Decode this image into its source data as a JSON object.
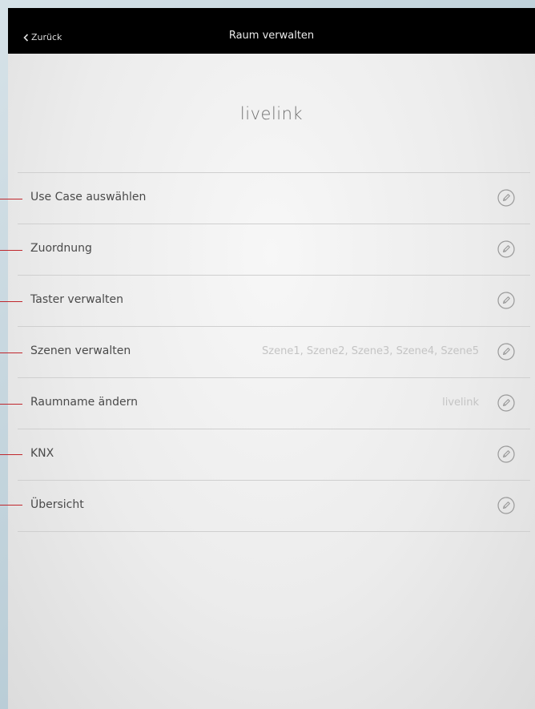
{
  "navbar": {
    "back_label": "Zurück",
    "title": "Raum verwalten"
  },
  "room": {
    "name": "livelink"
  },
  "items": [
    {
      "label": "Use Case auswählen",
      "value": ""
    },
    {
      "label": "Zuordnung",
      "value": ""
    },
    {
      "label": "Taster verwalten",
      "value": ""
    },
    {
      "label": "Szenen verwalten",
      "value": "Szene1, Szene2, Szene3, Szene4, Szene5"
    },
    {
      "label": "Raumname ändern",
      "value": "livelink"
    },
    {
      "label": "KNX",
      "value": ""
    },
    {
      "label": "Übersicht",
      "value": ""
    }
  ],
  "colors": {
    "navbar_bg": "#000000",
    "callout_line": "#c0272d",
    "label_text": "#4a4a4a",
    "value_text": "#c4c4c4"
  },
  "icons": {
    "back": "chevron-left-icon",
    "edit": "pencil-circle-icon"
  }
}
